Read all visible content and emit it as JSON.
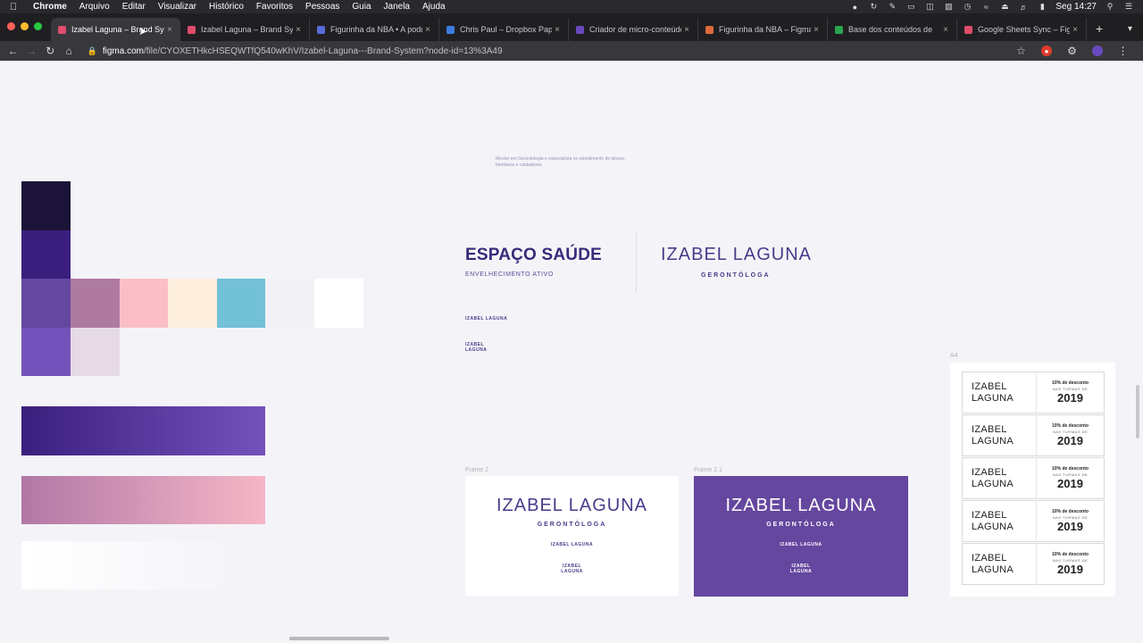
{
  "menubar": {
    "app": "Chrome",
    "items": [
      "Arquivo",
      "Editar",
      "Visualizar",
      "Histórico",
      "Favoritos",
      "Pessoas",
      "Guia",
      "Janela",
      "Ajuda"
    ],
    "clock": "Seg 14:27"
  },
  "tabs": [
    {
      "title": "Izabel Laguna – Brand System",
      "color": "#e04b6b",
      "active": true
    },
    {
      "title": "Izabel Laguna – Brand System",
      "color": "#e04b6b",
      "active": false
    },
    {
      "title": "Figurinha da NBA • A podcast",
      "color": "#5b6bd9",
      "active": false
    },
    {
      "title": "Chris Paul – Dropbox Paper",
      "color": "#3d7be0",
      "active": false
    },
    {
      "title": "Criador de micro-conteúdo",
      "color": "#6a4ac0",
      "active": false
    },
    {
      "title": "Figurinha da NBA – Figma",
      "color": "#e06a3b",
      "active": false
    },
    {
      "title": "Base dos conteúdos de",
      "color": "#2da44e",
      "active": false
    },
    {
      "title": "Google Sheets Sync – Figma",
      "color": "#e04b6b",
      "active": false
    }
  ],
  "address": {
    "domain": "figma.com",
    "path": "/file/CYOXETHkcHSEQWTfQ540wKhV/Izabel-Laguna---Brand-System?node-id=13%3A49"
  },
  "canvas": {
    "note": "Mestre em Gerontologia e especialista no atendimento de idosos, familiares e cuidadores.",
    "espaco_title": "ESPAÇO SAÚDE",
    "espaco_sub": "ENVELHECIMENTO ATIVO",
    "brand_name": "IZABEL LAGUNA",
    "brand_role": "GERONTÓLOGA",
    "mini_logo_line": "IZABEL LAGUNA",
    "mini_logo_stack_1": "IZABEL",
    "mini_logo_stack_2": "LAGUNA",
    "frame2_label": "Frame 2",
    "frame21_label": "Frame 2.1",
    "a4_label": "A4"
  },
  "ticket": {
    "name_1": "IZABEL",
    "name_2": "LAGUNA",
    "discount": "10% de desconto",
    "turmas": "NAS TURMAS DE",
    "year": "2019",
    "count": 5
  },
  "palette": {
    "deep": "#1c1438",
    "indigo": "#3b1f7e",
    "violet": "#65479f",
    "mauve": "#ae7aa0",
    "pink": "#fbbec8",
    "cream": "#fdeedd",
    "sky": "#72c1d6",
    "mist": "#f1f1f6",
    "white": "#ffffff",
    "lavender": "#7452bb",
    "blush": "#e6dae5"
  }
}
